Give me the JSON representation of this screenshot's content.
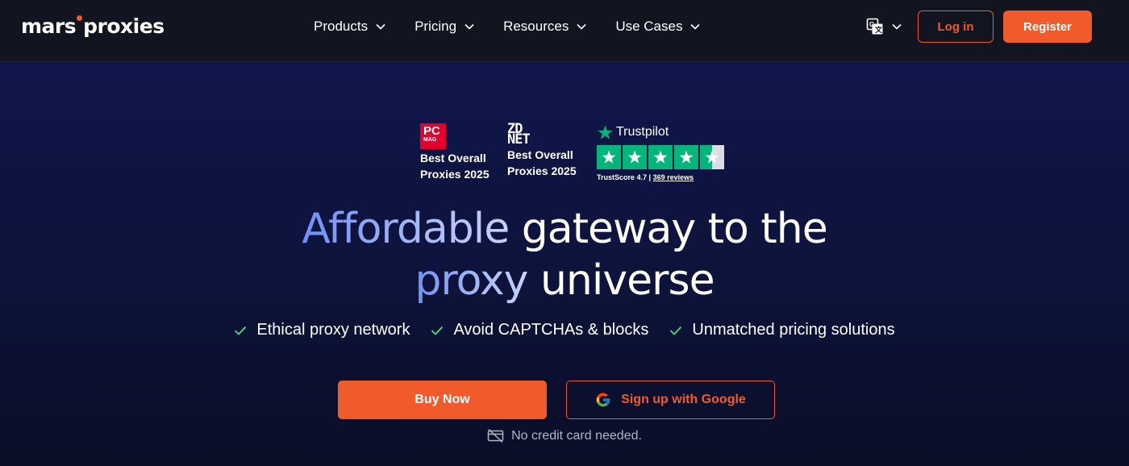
{
  "header": {
    "logo_left": "mars",
    "logo_right": "proxies",
    "nav": [
      {
        "label": "Products",
        "icon": "chevron-down-icon"
      },
      {
        "label": "Pricing",
        "icon": "chevron-down-icon"
      },
      {
        "label": "Resources",
        "icon": "chevron-down-icon"
      },
      {
        "label": "Use Cases",
        "icon": "chevron-down-icon"
      }
    ],
    "language_icon": "translate-icon",
    "login_label": "Log in",
    "register_label": "Register"
  },
  "awards": {
    "pcmag": {
      "logo_top": "PC",
      "logo_bottom": "MAG",
      "line1": "Best Overall",
      "line2": "Proxies 2025"
    },
    "zdnet": {
      "logo_top": "ZD",
      "logo_bottom": "NET",
      "line1": "Best Overall",
      "line2": "Proxies 2025"
    },
    "trustpilot": {
      "brand": "Trustpilot",
      "score_label": "TrustScore 4.7",
      "separator": "|",
      "reviews": "369 reviews",
      "rating": 4.7
    }
  },
  "hero": {
    "title_highlight_1": "Affordable",
    "title_rest_1": "gateway to the",
    "title_highlight_2": "proxy",
    "title_rest_2": "universe",
    "features": [
      "Ethical proxy network",
      "Avoid CAPTCHAs & blocks",
      "Unmatched pricing solutions"
    ],
    "buy_label": "Buy Now",
    "google_label": "Sign up with Google",
    "no_card": "No credit card needed."
  },
  "colors": {
    "accent": "#f15a2b",
    "header_bg": "#12151f",
    "hero_bg": "#10164a",
    "check": "#4ade80",
    "trustpilot": "#00b67a"
  }
}
